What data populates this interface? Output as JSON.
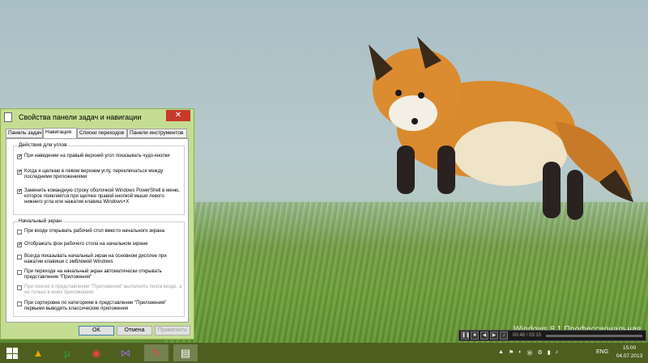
{
  "dialog": {
    "title": "Свойства панели задач и навигации",
    "close_glyph": "✕",
    "tabs": [
      "Панель задач",
      "Навигация",
      "Списки переходов",
      "Панели инструментов"
    ],
    "corner_group": {
      "label": "Действия для углов",
      "items": [
        {
          "text": "При наведении на правый верхний угол показывать чудо-кнопки",
          "checked": true,
          "disabled": false
        },
        {
          "text": "Когда я щелкаю в левом верхнем углу, переключаться между последними приложениями",
          "checked": true,
          "disabled": false
        },
        {
          "text": "Заменить командную строку оболочкой Windows PowerShell в меню, которое появляется при щелчке правой кнопкой мыши левого нижнего угла или нажатии клавиш Windows+X",
          "checked": true,
          "disabled": false
        }
      ]
    },
    "start_group": {
      "label": "Начальный экран",
      "items": [
        {
          "text": "При входе открывать рабочий стол вместо начального экрана",
          "checked": false,
          "disabled": false
        },
        {
          "text": "Отображать фон рабочего стола на начальном экране",
          "checked": true,
          "disabled": false
        },
        {
          "text": "Всегда показывать начальный экран на основном дисплее при нажатии клавиши с эмблемой Windows",
          "checked": false,
          "disabled": false
        },
        {
          "text": "При переходе на начальный экран автоматически открывать представление \"Приложения\"",
          "checked": false,
          "disabled": false
        },
        {
          "text": "При поиске в представлении \"Приложения\" выполнять поиск везде, а не только в моих приложениях",
          "checked": false,
          "disabled": true
        },
        {
          "text": "При сортировке по категориям в представлении \"Приложения\" первыми выводить классические приложения",
          "checked": false,
          "disabled": false
        }
      ]
    },
    "buttons": {
      "ok": "OK",
      "cancel": "Отмена",
      "apply": "Применить"
    }
  },
  "desktop": {
    "watermark": "Windows 8.1 Профессиональная Preview"
  },
  "media_player": {
    "time": "00:48 / 03:10"
  },
  "taskbar": {
    "apps": [
      {
        "name": "aimp-app",
        "glyph": "▲",
        "color": "#f0a400"
      },
      {
        "name": "utorrent-app",
        "glyph": "µ",
        "color": "#3aa13a"
      },
      {
        "name": "chrome-app",
        "glyph": "◉",
        "color": "#e8453c"
      },
      {
        "name": "visual-studio-app",
        "glyph": "⋈",
        "color": "#8e6ec8"
      },
      {
        "name": "paint-app",
        "glyph": "✎",
        "color": "#d94b4b"
      },
      {
        "name": "properties-app",
        "glyph": "▤",
        "color": "#ffffff"
      }
    ],
    "tray_icons": [
      "▲",
      "⚑",
      "◐",
      "Ⓦ",
      "⚙",
      "▮",
      "♪"
    ],
    "language": "ENG",
    "time": "15:00",
    "date": "04.07.2013"
  }
}
